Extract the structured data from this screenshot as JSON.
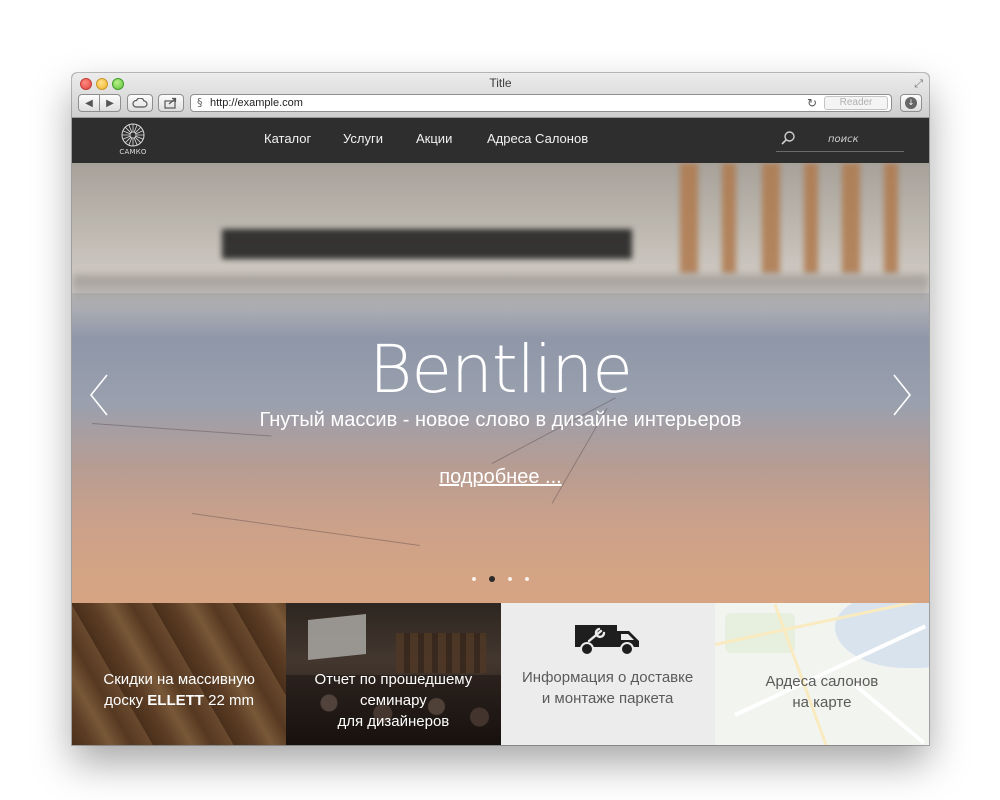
{
  "browser": {
    "window_title": "Title",
    "url": "http://example.com",
    "reader_label": "Reader"
  },
  "site": {
    "logo_text": "САМКО",
    "nav": [
      {
        "label": "Каталог"
      },
      {
        "label": "Услуги"
      },
      {
        "label": "Акции"
      },
      {
        "label": "Адреса Салонов"
      }
    ],
    "search": {
      "placeholder": "поиск"
    }
  },
  "hero": {
    "title": "Bentline",
    "subtitle": "Гнутый массив - новое слово в дизайне интерьеров",
    "more_link": "подробнее ...",
    "slides_count": 4,
    "active_slide": 2
  },
  "tiles": [
    {
      "line1": "Скидки на массивную",
      "line2_pre": "доску ",
      "line2_bold": "ELLETT",
      "line2_post": " 22 mm"
    },
    {
      "line1": "Отчет по прошедшему",
      "line2": "семинару",
      "line3": "для дизайнеров"
    },
    {
      "line1": "Информация о доставке",
      "line2": "и монтаже паркета",
      "icon": "delivery-van-icon"
    },
    {
      "line1": "Ардеса салонов",
      "line2": "на карте"
    }
  ],
  "colors": {
    "nav_bg": "#2e2e2e",
    "hero_text": "#ffffff",
    "tile_text_dark": "#5a5a5a"
  }
}
